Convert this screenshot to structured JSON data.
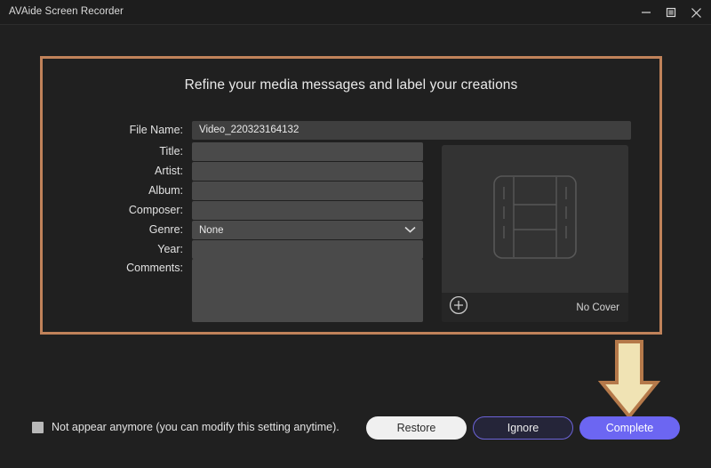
{
  "window": {
    "title": "AVAide Screen Recorder",
    "controls": [
      {
        "name": "minimize",
        "icon": "minimize-icon"
      },
      {
        "name": "maximize",
        "icon": "maximize-icon"
      },
      {
        "name": "close",
        "icon": "close-icon"
      }
    ]
  },
  "dialog": {
    "heading": "Refine your media messages and label your creations",
    "fields": [
      {
        "label": "File Name:",
        "value": "Video_220323164132",
        "placeholder": ""
      },
      {
        "label": "Title:",
        "value": "",
        "placeholder": ""
      },
      {
        "label": "Artist:",
        "value": "",
        "placeholder": ""
      },
      {
        "label": "Album:",
        "value": "",
        "placeholder": ""
      },
      {
        "label": "Composer:",
        "value": "",
        "placeholder": ""
      },
      {
        "label": "Genre:",
        "value": "None",
        "placeholder": ""
      },
      {
        "label": "Year:",
        "value": "",
        "placeholder": ""
      },
      {
        "label": "Comments:",
        "value": "",
        "placeholder": ""
      }
    ],
    "genre_selected": "None",
    "cover": {
      "placeholder_icon": "film-strip-icon",
      "add_icon": "plus-circle-icon",
      "status_label": "No Cover"
    }
  },
  "footer": {
    "checkbox_label": "Not appear anymore (you can modify this setting anytime).",
    "checkbox_checked": false,
    "restore_label": "Restore",
    "ignore_label": "Ignore",
    "complete_label": "Complete"
  },
  "annotations": {
    "arrow_target": "Complete",
    "highlight_region": "metadata form"
  },
  "colors": {
    "window_bg": "#202020",
    "titlebar_bg": "#1d1d1d",
    "field_bg": "#4a4a4a",
    "highlight_border": "#c0825a",
    "accent_purple": "#6c66f2",
    "arrow_fill": "#f0e3b4",
    "arrow_stroke": "#b5794a"
  }
}
